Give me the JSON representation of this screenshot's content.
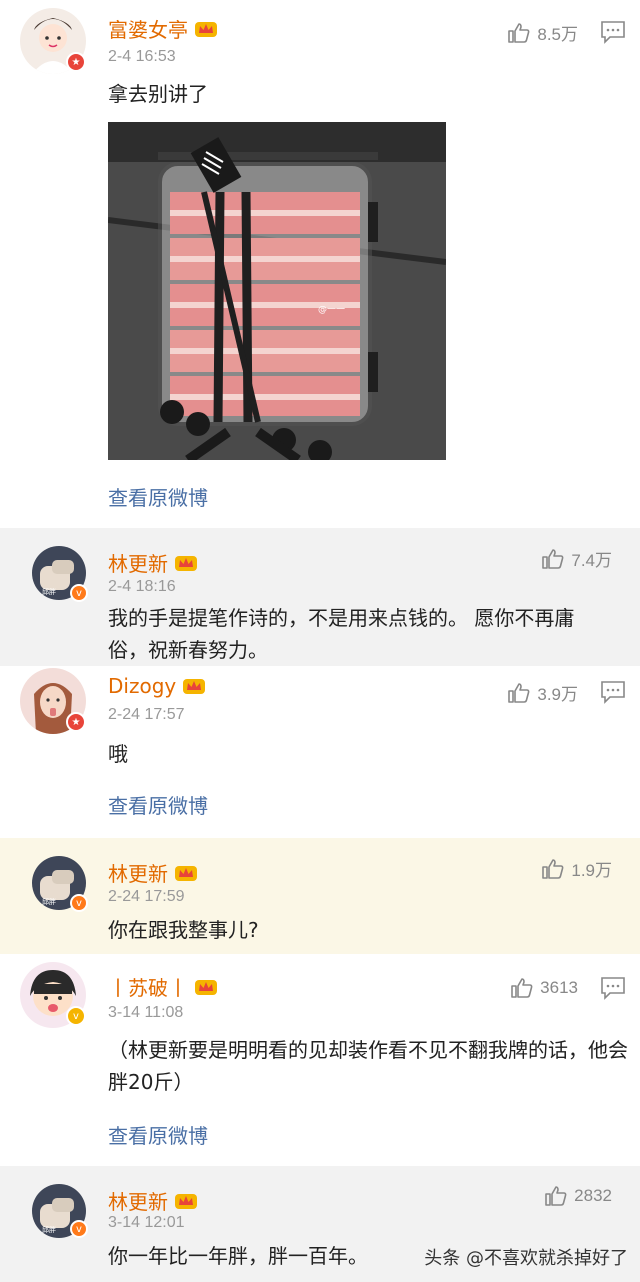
{
  "comments": [
    {
      "name": "富婆女亭",
      "time": "2-4 16:53",
      "likes": "8.5万",
      "text": "拿去别讲了",
      "link": "查看原微博"
    },
    {
      "name": "林更新",
      "time": "2-4 18:16",
      "likes": "7.4万",
      "text": "我的手是提笔作诗的，不是用来点钱的。 愿你不再庸俗，祝新春努力。"
    },
    {
      "name": "Dizogy",
      "time": "2-24 17:57",
      "likes": "3.9万",
      "text": "哦",
      "link": "查看原微博"
    },
    {
      "name": "林更新",
      "time": "2-24 17:59",
      "likes": "1.9万",
      "text": "你在跟我整事儿?"
    },
    {
      "name": "丨苏破丨",
      "time": "3-14 11:08",
      "likes": "3613",
      "text": "（林更新要是明明看的见却装作看不见不翻我牌的话，他会胖20斤）",
      "link": "查看原微博"
    },
    {
      "name": "林更新",
      "time": "3-14 12:01",
      "likes": "2832",
      "text": "你一年比一年胖，胖一百年。"
    }
  ],
  "photo_watermark": "@一一",
  "watermark": "头条 @不喜欢就杀掉好了",
  "colors": {
    "name": "#e26a00",
    "link": "#4a6fa5",
    "reply_bg": "#f2f2f2",
    "highlight_bg": "#fbf7e6"
  },
  "icons": [
    "thumbs-up-icon",
    "comment-icon",
    "crown-icon",
    "verified-badge-icon"
  ]
}
